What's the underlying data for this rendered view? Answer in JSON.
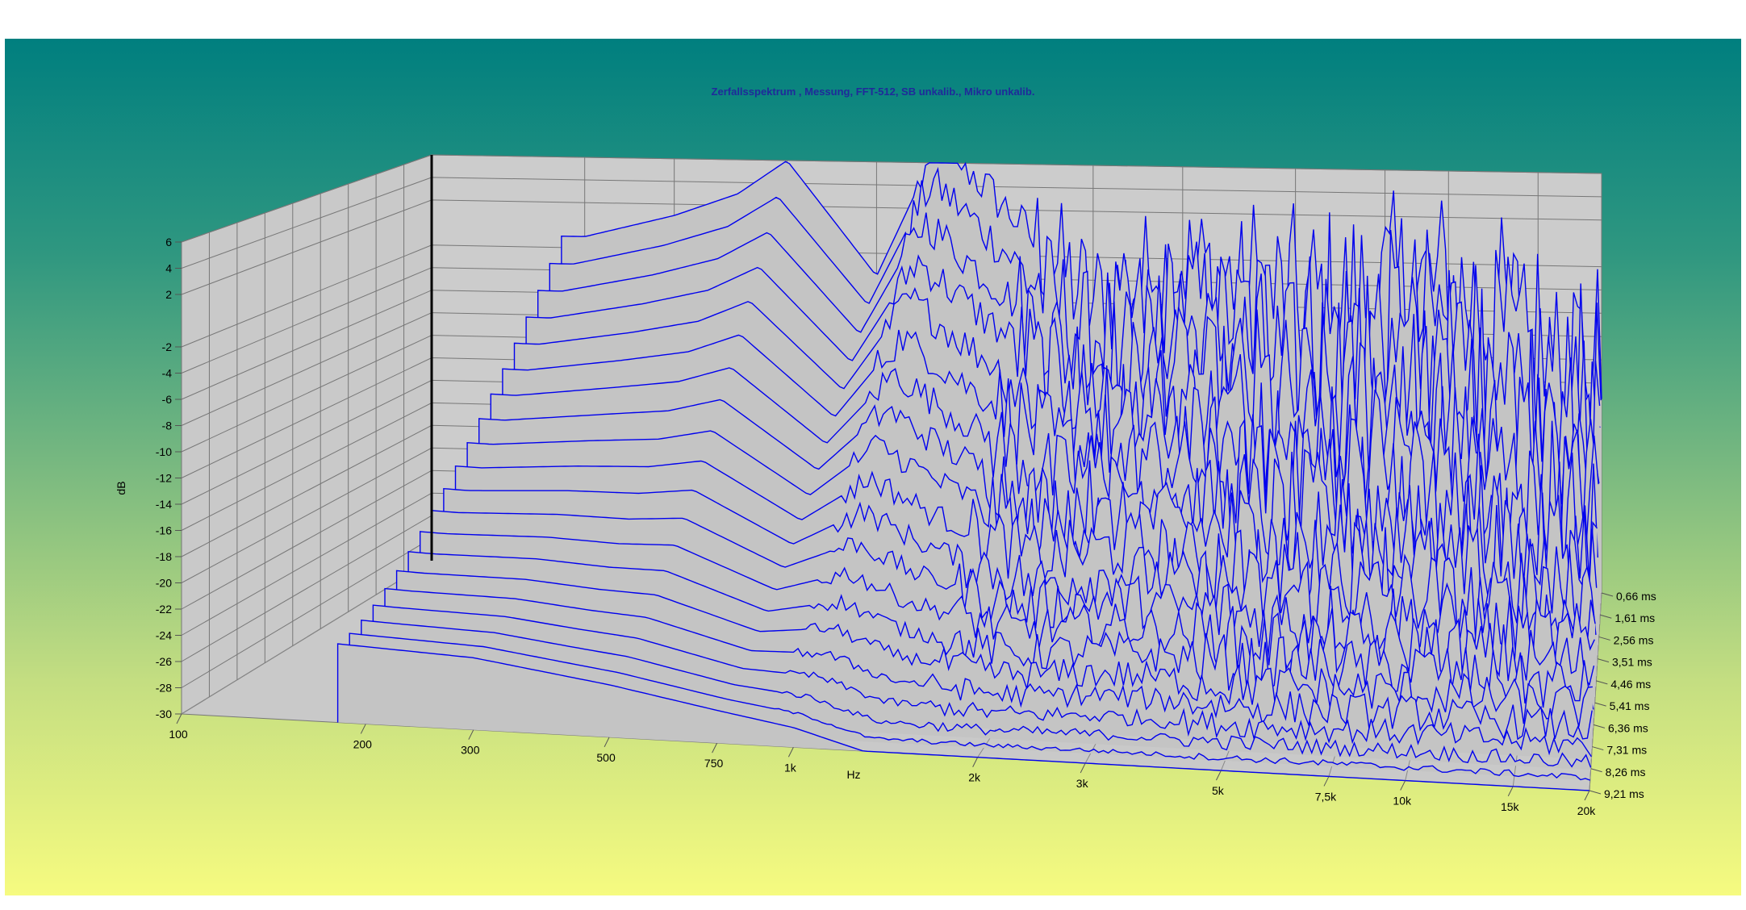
{
  "chart_data": {
    "type": "waterfall",
    "title": "Zerfallsspektrum , Messung, FFT-512, SB unkalib., Mikro unkalib.",
    "xlabel": "Hz",
    "ylabel": "dB",
    "zlabel": "",
    "x_scale": "log",
    "xlim": [
      100,
      20000
    ],
    "ylim": [
      -30,
      6
    ],
    "x_ticks": [
      "100",
      "200",
      "300",
      "500",
      "750",
      "1k",
      "2k",
      "3k",
      "5k",
      "7,5k",
      "10k",
      "15k",
      "20k"
    ],
    "x_tick_values": [
      100,
      200,
      300,
      500,
      750,
      1000,
      2000,
      3000,
      5000,
      7500,
      10000,
      15000,
      20000
    ],
    "y_ticks": [
      "6",
      "4",
      "2",
      "-2",
      "-4",
      "-6",
      "-8",
      "-10",
      "-12",
      "-14",
      "-16",
      "-18",
      "-20",
      "-22",
      "-24",
      "-26",
      "-28",
      "-30"
    ],
    "y_tick_values": [
      6,
      4,
      2,
      -2,
      -4,
      -6,
      -8,
      -10,
      -12,
      -14,
      -16,
      -18,
      -20,
      -22,
      -24,
      -26,
      -28,
      -30
    ],
    "z_ticks": [
      "0,66 ms",
      "1,61 ms",
      "2,56 ms",
      "3,51 ms",
      "4,46 ms",
      "5,41 ms",
      "6,36 ms",
      "7,31 ms",
      "8,26 ms",
      "9,21 ms"
    ],
    "z_tick_values": [
      0.66,
      1.61,
      2.56,
      3.51,
      4.46,
      5.41,
      6.36,
      7.31,
      8.26,
      9.21
    ],
    "slice_count": 20,
    "grid": true,
    "colors": {
      "trace": "#0000ee",
      "fill": "#c4c4c4",
      "grid": "#777777",
      "title": "#1f2a9a"
    },
    "front_slice_approx": {
      "freq_hz": [
        180,
        300,
        500,
        750,
        1000,
        1300,
        2000,
        3000,
        5000,
        10000,
        20000
      ],
      "db": [
        -24,
        -24.5,
        -26,
        -27.5,
        -28.5,
        -30,
        -30,
        -30,
        -30,
        -30,
        -30
      ]
    },
    "back_slice_approx": {
      "freq_hz": [
        200,
        300,
        400,
        500,
        750,
        1000,
        1500,
        2000,
        3000,
        5000,
        10000,
        15000,
        20000
      ],
      "db": [
        -1,
        1,
        3,
        6,
        -4,
        8,
        0,
        -6,
        -2,
        -6,
        -4,
        -8,
        -10
      ]
    }
  }
}
